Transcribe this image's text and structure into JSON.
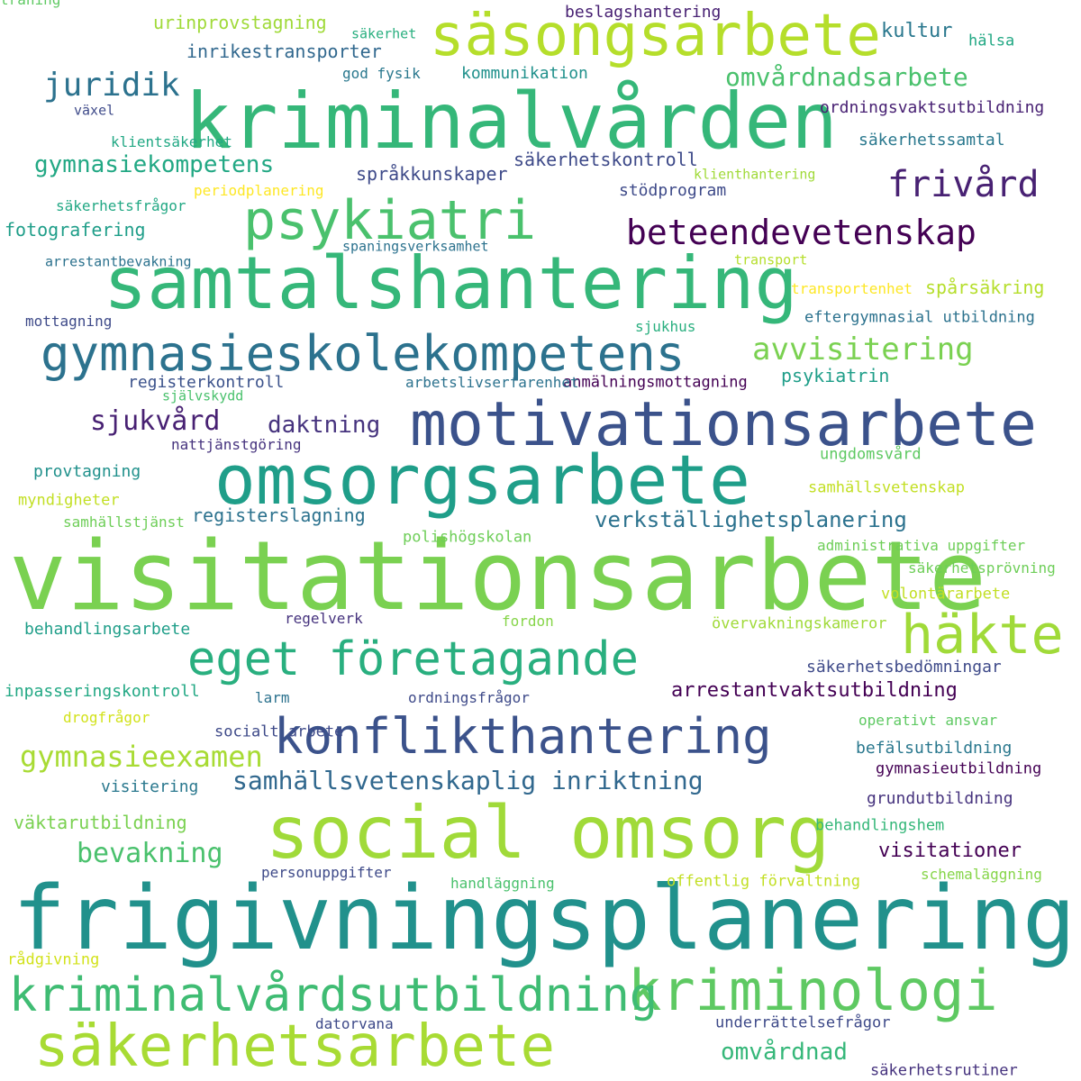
{
  "palette": {
    "dark-purple": "#440154",
    "indigo": "#3e4a89",
    "blue": "#31688e",
    "teal": "#26828e",
    "green-teal": "#1f9e89",
    "green": "#35b779",
    "light-green": "#6ece58",
    "yellow-green": "#b5de2b",
    "yellow": "#fde725"
  },
  "words": [
    {
      "text": "frigivningsplanering",
      "color": "#21918c"
    },
    {
      "text": "visitationsarbete",
      "color": "#7ad151"
    },
    {
      "text": "kriminalvården",
      "color": "#35b779"
    },
    {
      "text": "samtalshantering",
      "color": "#35b779"
    },
    {
      "text": "social omsorg",
      "color": "#a0da39"
    },
    {
      "text": "säkerhetsarbete",
      "color": "#a8db34"
    },
    {
      "text": "omsorgsarbete",
      "color": "#1f9e89"
    },
    {
      "text": "motivationsarbete",
      "color": "#3b528b"
    },
    {
      "text": "säsongsarbete",
      "color": "#b5de2b"
    },
    {
      "text": "kriminologi",
      "color": "#5ec962"
    },
    {
      "text": "psykiatri",
      "color": "#4ac16d"
    },
    {
      "text": "gymnasieskolekompetens",
      "color": "#2c728e"
    },
    {
      "text": "kriminalvårdsutbildning",
      "color": "#3fbc73"
    },
    {
      "text": "konflikthantering",
      "color": "#3b528b"
    },
    {
      "text": "eget företagande",
      "color": "#29af7f"
    },
    {
      "text": "häkte",
      "color": "#a0da39"
    },
    {
      "text": "beteendevetenskap",
      "color": "#440154"
    },
    {
      "text": "frivård",
      "color": "#482173"
    },
    {
      "text": "juridik",
      "color": "#2c728e"
    },
    {
      "text": "avvisitering",
      "color": "#7ad151"
    },
    {
      "text": "gymnasieexamen",
      "color": "#a8db34"
    },
    {
      "text": "bevakning",
      "color": "#4ac16d"
    },
    {
      "text": "omvårdnadsarbete",
      "color": "#4ac16d"
    },
    {
      "text": "sjukvård",
      "color": "#482173"
    },
    {
      "text": "gymnasiekompetens",
      "color": "#22a884"
    },
    {
      "text": "samhällsvetenskaplig inriktning",
      "color": "#31688e"
    },
    {
      "text": "verkställighetsplanering",
      "color": "#2c728e"
    },
    {
      "text": "daktning",
      "color": "#46337e"
    },
    {
      "text": "omvårdnad",
      "color": "#35b779"
    },
    {
      "text": "kultur",
      "color": "#2a788e"
    },
    {
      "text": "arrestantvaktsutbildning",
      "color": "#440154"
    },
    {
      "text": "visitationer",
      "color": "#440154"
    },
    {
      "text": "urinprovstagning",
      "color": "#a0da39"
    },
    {
      "text": "inrikestransporter",
      "color": "#31688e"
    },
    {
      "text": "språkkunskaper",
      "color": "#3e4a89"
    },
    {
      "text": "fotografering",
      "color": "#1f9e89"
    },
    {
      "text": "säkerhetskontroll",
      "color": "#3e4a89"
    },
    {
      "text": "psykiatrin",
      "color": "#1f9e89"
    },
    {
      "text": "spårsäkring",
      "color": "#b5de2b"
    },
    {
      "text": "registerslagning",
      "color": "#2c728e"
    },
    {
      "text": "registerkontroll",
      "color": "#3b528b"
    },
    {
      "text": "provtagning",
      "color": "#21918c"
    },
    {
      "text": "väktarutbildning",
      "color": "#7ad151"
    },
    {
      "text": "grundutbildning",
      "color": "#46337e"
    },
    {
      "text": "behandlingsarbete",
      "color": "#1f9e89"
    },
    {
      "text": "befälsutbildning",
      "color": "#2a788e"
    },
    {
      "text": "säkerhetsbedömningar",
      "color": "#3e4a89"
    },
    {
      "text": "inpasseringskontroll",
      "color": "#22a884"
    },
    {
      "text": "stödprogram",
      "color": "#3e4a89"
    },
    {
      "text": "beslagshantering",
      "color": "#482173"
    },
    {
      "text": "ordningsvaktsutbildning",
      "color": "#482173"
    },
    {
      "text": "kommunikation",
      "color": "#21918c"
    },
    {
      "text": "säkerhetssamtal",
      "color": "#2a788e"
    },
    {
      "text": "eftergymnasial utbildning",
      "color": "#2c728e"
    },
    {
      "text": "anmälningsmottagning",
      "color": "#440154"
    },
    {
      "text": "ungdomsvård",
      "color": "#5ec962"
    },
    {
      "text": "samhällsvetenskap",
      "color": "#c2df23"
    },
    {
      "text": "administrativa uppgifter",
      "color": "#6ece58"
    },
    {
      "text": "volontärarbete",
      "color": "#c2df23"
    },
    {
      "text": "gymnasieutbildning",
      "color": "#440154"
    },
    {
      "text": "operativt ansvar",
      "color": "#5ec962"
    },
    {
      "text": "behandlingshem",
      "color": "#35b779"
    },
    {
      "text": "schemaläggning",
      "color": "#86d549"
    },
    {
      "text": "säkerhetsrutiner",
      "color": "#46337e"
    },
    {
      "text": "underrättelsefrågor",
      "color": "#3e4a89"
    },
    {
      "text": "offentlig förvaltning",
      "color": "#c2df23"
    },
    {
      "text": "handläggning",
      "color": "#4ac16d"
    },
    {
      "text": "datorvana",
      "color": "#3e4a89"
    },
    {
      "text": "rådgivning",
      "color": "#d2e21b"
    },
    {
      "text": "personuppgifter",
      "color": "#3e4a89"
    },
    {
      "text": "visitering",
      "color": "#2a788e"
    },
    {
      "text": "drogfrågor",
      "color": "#d2e21b"
    },
    {
      "text": "socialt arbete",
      "color": "#3e4a89"
    },
    {
      "text": "larm",
      "color": "#2c728e"
    },
    {
      "text": "ordningsfrågor",
      "color": "#3e4a89"
    },
    {
      "text": "regelverk",
      "color": "#46337e"
    },
    {
      "text": "fordon",
      "color": "#86d549"
    },
    {
      "text": "övervakningskameror",
      "color": "#a0da39"
    },
    {
      "text": "polishögskolan",
      "color": "#6ece58"
    },
    {
      "text": "säkerhetsprövning",
      "color": "#6ece58"
    },
    {
      "text": "samhällstjänst",
      "color": "#6ece58"
    },
    {
      "text": "myndigheter",
      "color": "#c2df23"
    },
    {
      "text": "nattjänstgöring",
      "color": "#46337e"
    },
    {
      "text": "självskydd",
      "color": "#4ac16d"
    },
    {
      "text": "arbetslivserfarenhet",
      "color": "#2c728e"
    },
    {
      "text": "sjukhus",
      "color": "#29af7f"
    },
    {
      "text": "mottagning",
      "color": "#3e4a89"
    },
    {
      "text": "transportenhet",
      "color": "#fde725"
    },
    {
      "text": "transport",
      "color": "#b5de2b"
    },
    {
      "text": "spaningsverksamhet",
      "color": "#2c728e"
    },
    {
      "text": "arrestantbevakning",
      "color": "#2c728e"
    },
    {
      "text": "säkerhetsfrågor",
      "color": "#22a884"
    },
    {
      "text": "periodplanering",
      "color": "#fde725"
    },
    {
      "text": "klienthantering",
      "color": "#a0da39"
    },
    {
      "text": "klientsäkerhet",
      "color": "#22a884"
    },
    {
      "text": "växel",
      "color": "#3e4a89"
    },
    {
      "text": "god fysik",
      "color": "#2a788e"
    },
    {
      "text": "säkerhet",
      "color": "#29af7f"
    },
    {
      "text": "hälsa",
      "color": "#22a884"
    },
    {
      "text": "träning",
      "color": "#5ec962"
    }
  ]
}
